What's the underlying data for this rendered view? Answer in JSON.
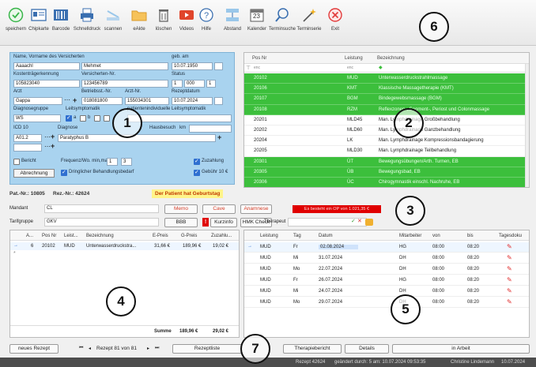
{
  "toolbar": {
    "items": [
      {
        "label": "speichern",
        "icon": "check-circle-icon"
      },
      {
        "label": "Chipkarte",
        "icon": "id-card-icon"
      },
      {
        "label": "Barcode",
        "icon": "barcode-icon"
      },
      {
        "label": "Schnelldruck",
        "icon": "printer-icon"
      },
      {
        "label": "scannen",
        "icon": "scanner-icon"
      },
      {
        "label": "eAkte",
        "icon": "folder-icon"
      },
      {
        "label": "löschen",
        "icon": "trash-icon"
      },
      {
        "label": "Videos",
        "icon": "video-icon"
      },
      {
        "label": "Hilfe",
        "icon": "help-icon"
      },
      {
        "label": "Abstand",
        "icon": "spacing-icon"
      },
      {
        "label": "Kalender",
        "icon": "calendar-icon"
      },
      {
        "label": "Terminsuche",
        "icon": "search-icon"
      },
      {
        "label": "Terminserie",
        "icon": "magic-wand-icon"
      },
      {
        "label": "Exit",
        "icon": "exit-icon"
      }
    ],
    "calendar_day": "23"
  },
  "callouts": [
    "1",
    "2",
    "3",
    "4",
    "5",
    "6",
    "7"
  ],
  "form": {
    "name_label": "Name, Vorname des Versicherten",
    "geb_label": "geb. am",
    "lastname": "Aaaachl",
    "firstname": "Mehmet",
    "birthdate": "10.07.1950",
    "kostentraeger_label": "Kostenträgerkennung",
    "versicherten_label": "Versicherten-Nr.",
    "status_label": "Status",
    "kostentraeger": "105823040",
    "versicherten_nr": "123456789",
    "status1": "1",
    "status2": "000",
    "status3": "1",
    "arzt_label": "Arzt",
    "betriebsst_label": "Betriebsst.-Nr.",
    "arztnr_label": "Arzt-Nr.",
    "rezeptdatum_label": "Rezeptdatum",
    "arzt": "Gappa",
    "betriebsst": "018081800",
    "arztnr": "155034301",
    "rezeptdatum": "10.07.2024",
    "diagnosegruppe_label": "Diagnosegruppe",
    "leitsymptomatik_label": "Leitsymptomatik",
    "patientenindividuelle_label": "patientenindividuelle Leitsymptomatik",
    "diagnosegruppe": "WS",
    "ls_a": "a",
    "ls_b": "b",
    "icd_label": "ICD 10",
    "diagnose_label": "Diagnose",
    "hausbesuch_label": "Hausbesuch",
    "km_label": "km",
    "icd": "A01.2",
    "diagnose": "Paratyphus B",
    "bericht_label": "Bericht",
    "frequenz_label": "Frequenz/Wo. min,max",
    "freq_min": "1",
    "freq_max": "3",
    "zuzahlung_label": "Zuzahlung",
    "abrechnung_label": "Abrechnung",
    "dringlich_label": "Dringlicher Behandlungsbedarf",
    "gebuehr_label": "Gebühr 10 €"
  },
  "grid": {
    "headers": [
      "Pos Nr",
      "Leistung",
      "Bezeichnung"
    ],
    "filter": [
      "enc",
      "enc"
    ],
    "rows": [
      {
        "pos": "20102",
        "leistung": "MUD",
        "bez": "Unterwasserdruckstrahlmassage",
        "green": true
      },
      {
        "pos": "20106",
        "leistung": "KMT",
        "bez": "Klassische Massagetherapie (KMT)",
        "green": true
      },
      {
        "pos": "20107",
        "leistung": "BGM",
        "bez": "Bindegewebsmassage (BGM)",
        "green": true
      },
      {
        "pos": "20108",
        "leistung": "RZM",
        "bez": "Reflexzonen-, Segment-, Periost und Colonmassage",
        "green": true
      },
      {
        "pos": "20201",
        "leistung": "MLD45",
        "bez": "Man. Lymphdrainage Großbehandlung",
        "green": false
      },
      {
        "pos": "20202",
        "leistung": "MLD60",
        "bez": "Man. Lymphdrainage Ganzbehandlung",
        "green": false
      },
      {
        "pos": "20204",
        "leistung": "LK",
        "bez": "Man. Lymphdrainage Kompressionsbandagierung",
        "green": false
      },
      {
        "pos": "20205",
        "leistung": "MLD30",
        "bez": "Man. Lymphdrainage Teilbehandlung",
        "green": false
      },
      {
        "pos": "20301",
        "leistung": "ÜT",
        "bez": "Bewegungsübungen/Arth. Turnen, EB",
        "green": true
      },
      {
        "pos": "20305",
        "leistung": "ÜB",
        "bez": "Bewegungsbad, EB",
        "green": true
      },
      {
        "pos": "20306",
        "leistung": "ÜC",
        "bez": "Chirogymnastik einschl. Nachruhe, EB",
        "green": true
      }
    ]
  },
  "info": {
    "patnr": "Pat.-Nr.: 10805",
    "reznr": "Rez.-Nr.: 42624",
    "birthday_msg": "Der Patient hat Geburtstag",
    "mandant_label": "Mandant",
    "mandant": "CL",
    "tarif_label": "Tarifgruppe",
    "tarif": "GKV",
    "memo": "Memo",
    "cave": "Cave",
    "anamnese": "Anamnese",
    "op_msg": "Es besteht ein OP von 1.021,35 €",
    "bbb": "BBB",
    "kurzinfo": "Kurzinfo",
    "hmk": "HMK Check",
    "therapeut_label": "Therapeut"
  },
  "tbl4": {
    "headers": [
      "A...",
      "Pos Nr",
      "Leist...",
      "Bezeichnung",
      "E-Preis",
      "G-Preis",
      "Zuzahlu..."
    ],
    "row": [
      "6",
      "20102",
      "MUD",
      "Unterwasserdruckstra...",
      "31,66 €",
      "189,96 €",
      "19,02 €"
    ],
    "summe_label": "Summe",
    "summe_g": "189,96 €",
    "summe_z": "29,02 €"
  },
  "tbl5": {
    "headers": [
      "Leistung",
      "Tag",
      "Datum",
      "Mitarbeiter",
      "von",
      "bis",
      "Tagesdoku"
    ],
    "rows": [
      [
        "MUD",
        "Fr",
        "02.08.2024",
        "HG",
        "08:00",
        "08:20"
      ],
      [
        "MUD",
        "Mi",
        "31.07.2024",
        "DH",
        "08:00",
        "08:20"
      ],
      [
        "MUD",
        "Mo",
        "22.07.2024",
        "DH",
        "08:00",
        "08:20"
      ],
      [
        "MUD",
        "Fr",
        "26.07.2024",
        "HG",
        "08:00",
        "08:20"
      ],
      [
        "MUD",
        "Mi",
        "24.07.2024",
        "DH",
        "08:00",
        "08:20"
      ],
      [
        "MUD",
        "Mo",
        "29.07.2024",
        "DH",
        "08:00",
        "08:20"
      ]
    ]
  },
  "bottom": {
    "neues": "neues Rezept",
    "nav": "Rezept 81 von 81",
    "liste": "Rezeptliste",
    "bericht": "Therapiebericht",
    "details": "Details",
    "arbeit": "in Arbeit"
  },
  "status": {
    "rezept": "Rezept 42624",
    "geaendert": "geändert durch: 5 am: 10.07.2024 09:53:35",
    "user": "Christine Lindemann",
    "date": "10.07.2024"
  },
  "colors": {
    "green": "#3cbf3c",
    "form_bg": "#a9d3ef",
    "status_bg": "#4d4d4d"
  }
}
